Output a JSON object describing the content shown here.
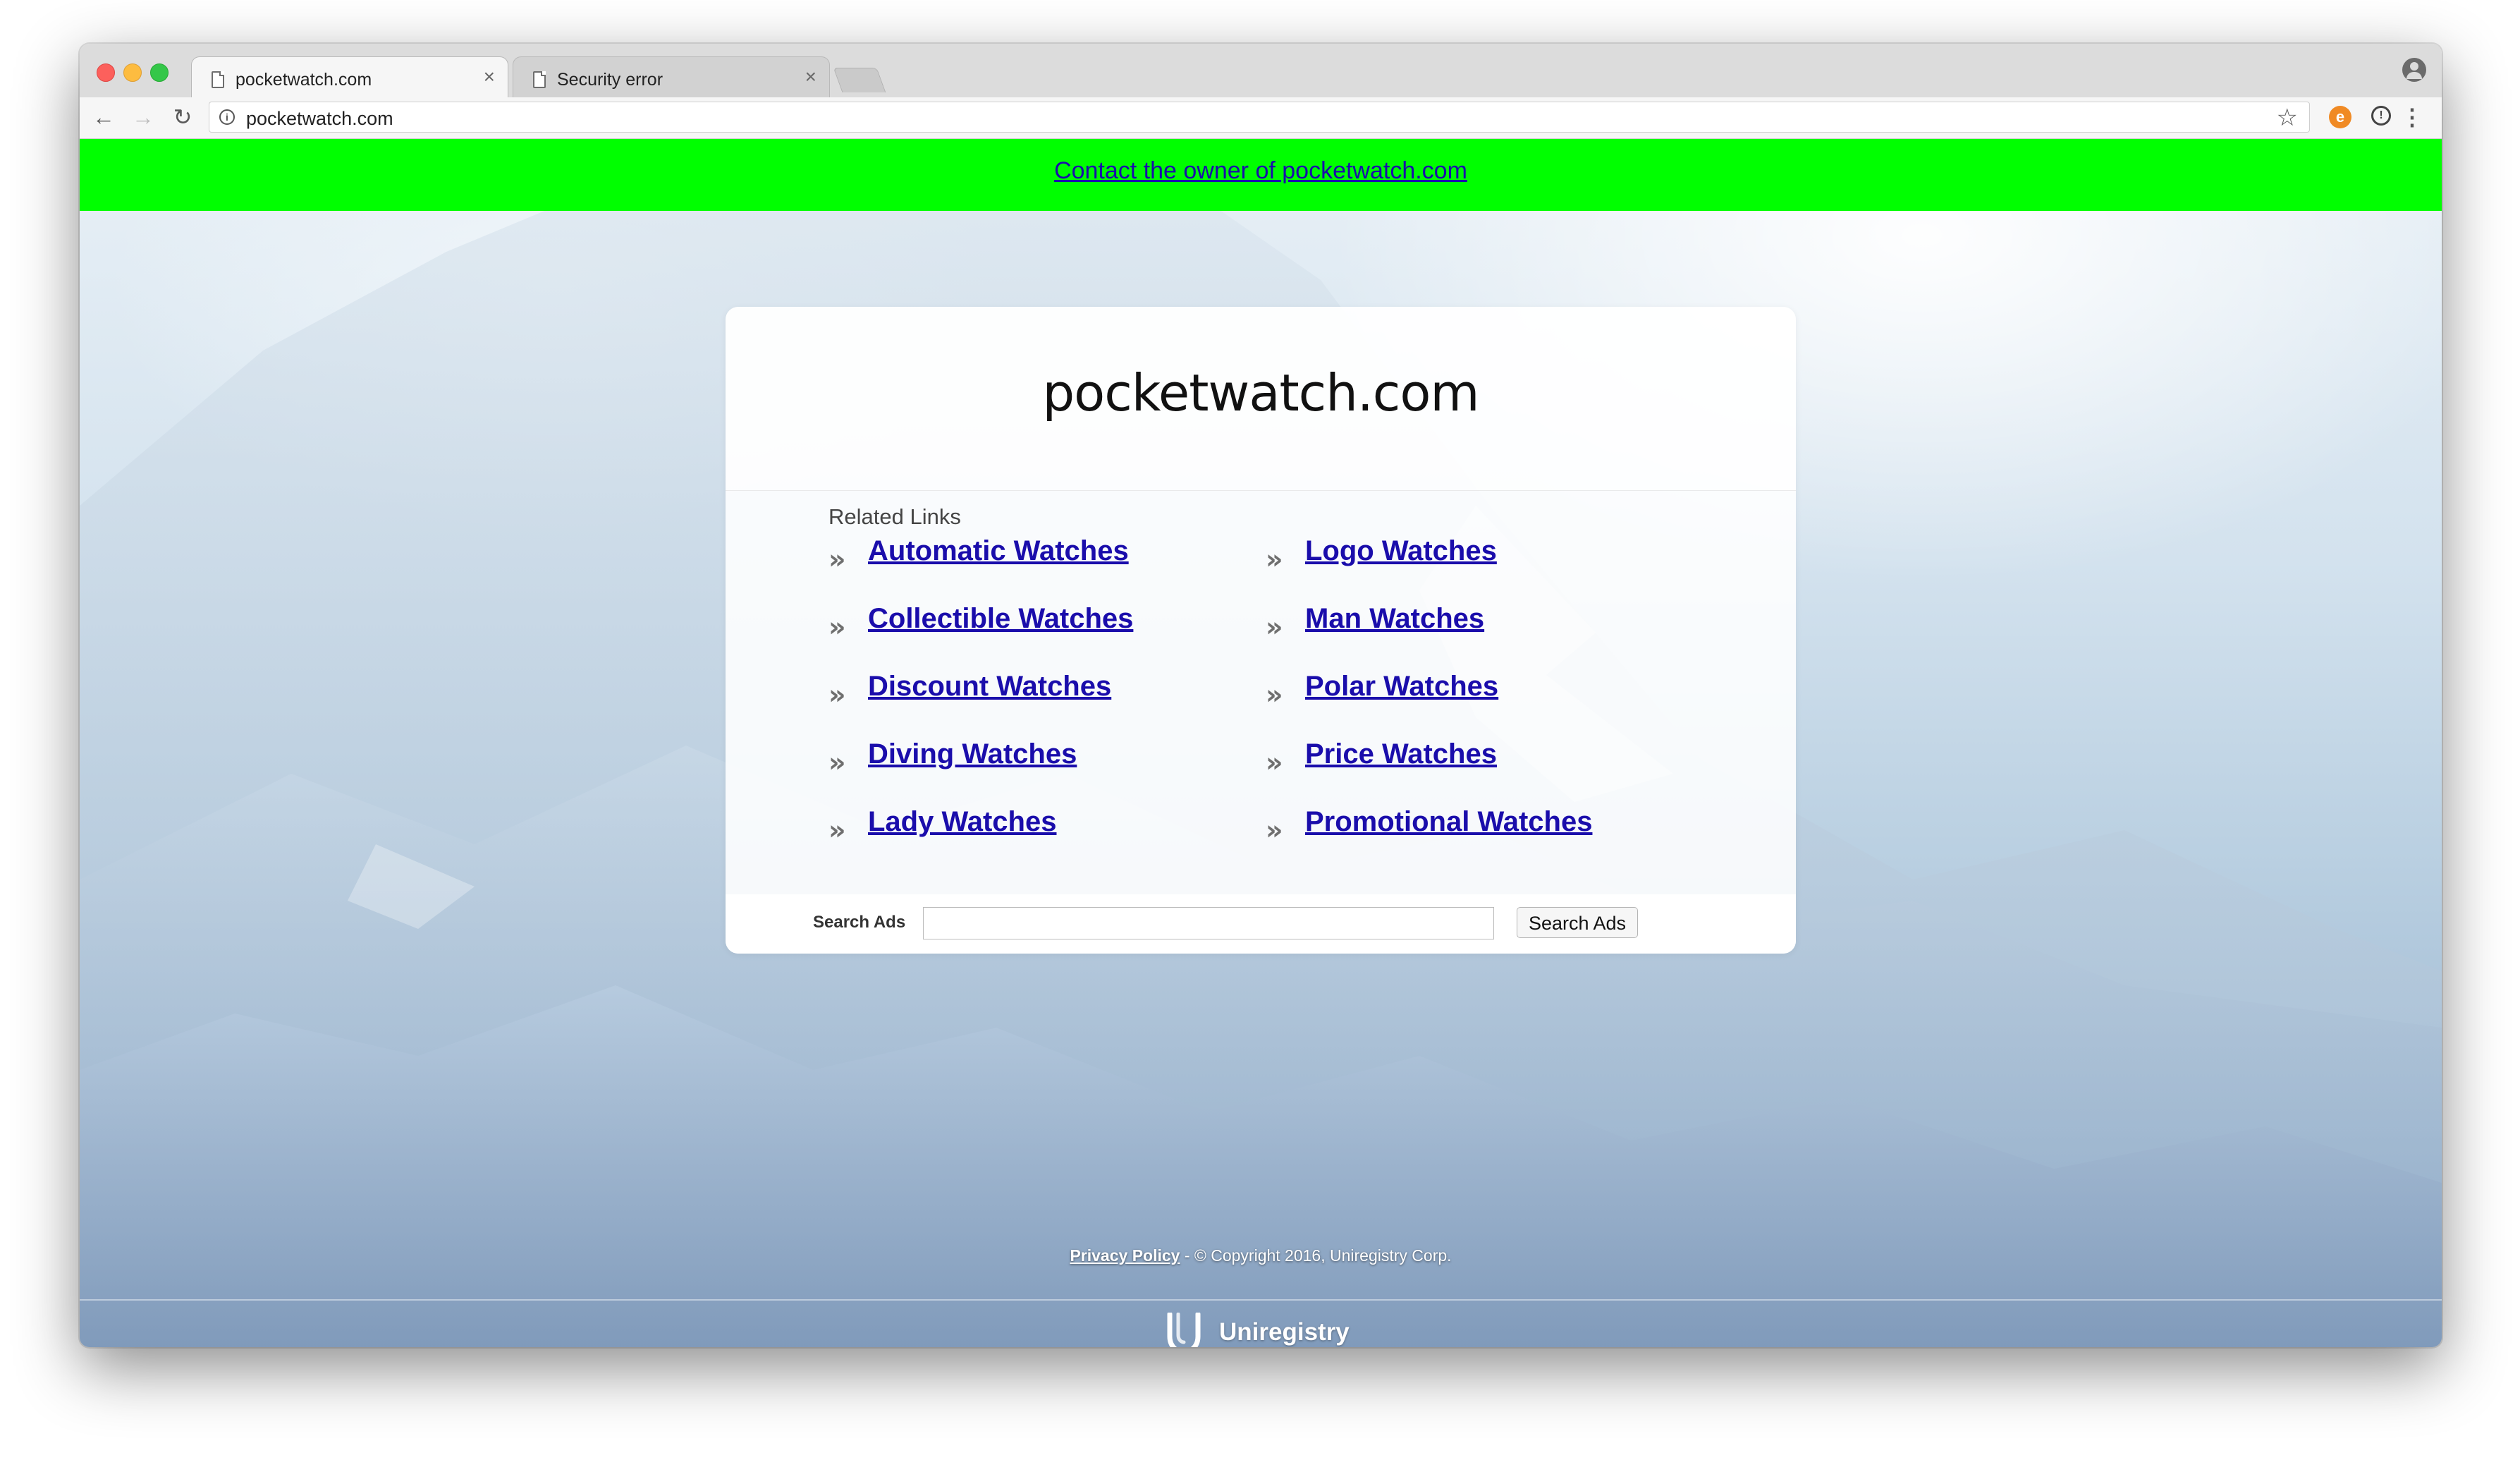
{
  "browser": {
    "tabs": [
      {
        "title": "pocketwatch.com",
        "active": true
      },
      {
        "title": "Security error",
        "active": false
      }
    ],
    "close_glyph": "×",
    "address": "pocketwatch.com",
    "nav": {
      "back": "←",
      "forward": "→",
      "reload": "↻"
    },
    "icons": {
      "star": "☆",
      "menu": "⋮",
      "extension1": "e",
      "extension2": "!",
      "site_info": "i"
    }
  },
  "banner": {
    "link_text": "Contact the owner of pocketwatch.com",
    "color": "#00ff00"
  },
  "card": {
    "domain": "pocketwatch.com",
    "related_heading": "Related Links",
    "chevron": "»",
    "links_left": [
      "Automatic Watches",
      "Collectible Watches",
      "Discount Watches",
      "Diving Watches",
      "Lady Watches"
    ],
    "links_right": [
      "Logo Watches",
      "Man Watches",
      "Polar Watches",
      "Price Watches",
      "Promotional Watches"
    ],
    "search_label": "Search Ads",
    "search_button": "Search Ads",
    "search_value": ""
  },
  "footer": {
    "privacy_link": "Privacy Policy",
    "copyright": " - © Copyright 2016, Uniregistry Corp.",
    "brand": "Uniregistry"
  },
  "colors": {
    "link": "#1a0dab",
    "banner": "#00ff00"
  }
}
